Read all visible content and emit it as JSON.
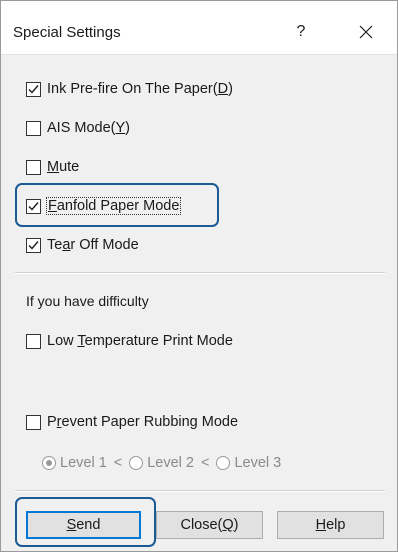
{
  "window": {
    "title": "Special Settings",
    "help_label": "?"
  },
  "options": {
    "ink_prefire": {
      "before": "Ink Pre-fire On The Paper(",
      "mnemonic": "D",
      "after": ")",
      "checked": true
    },
    "ais_mode": {
      "before": "AIS Mode(",
      "mnemonic": "Y",
      "after": ")",
      "checked": false
    },
    "mute": {
      "before": "",
      "mnemonic": "M",
      "after": "ute",
      "checked": false
    },
    "fanfold": {
      "before": "",
      "mnemonic": "F",
      "after": "anfold Paper Mode",
      "checked": true
    },
    "tear_off": {
      "before": "Te",
      "mnemonic": "a",
      "after": "r Off Mode",
      "checked": true
    }
  },
  "difficulty": {
    "heading": "If you have difficulty",
    "low_temp": {
      "before": "Low ",
      "mnemonic": "T",
      "after": "emperature Print Mode",
      "checked": false
    },
    "prevent_rubbing": {
      "before": "P",
      "mnemonic": "r",
      "after": "event Paper Rubbing Mode",
      "checked": false
    },
    "levels": [
      {
        "label": "Level 1",
        "selected": true
      },
      {
        "label": "Level 2",
        "selected": false
      },
      {
        "label": "Level 3",
        "selected": false
      }
    ],
    "separator_symbol": "<"
  },
  "buttons": {
    "send": {
      "before": "",
      "mnemonic": "S",
      "after": "end"
    },
    "close": {
      "before": "Close(",
      "mnemonic": "Q",
      "after": ")"
    },
    "help": {
      "before": "",
      "mnemonic": "H",
      "after": "elp"
    }
  },
  "colors": {
    "highlight_border": "#1c5a96",
    "default_button_border": "#0078d7",
    "disabled_text": "#8a8a8a"
  }
}
